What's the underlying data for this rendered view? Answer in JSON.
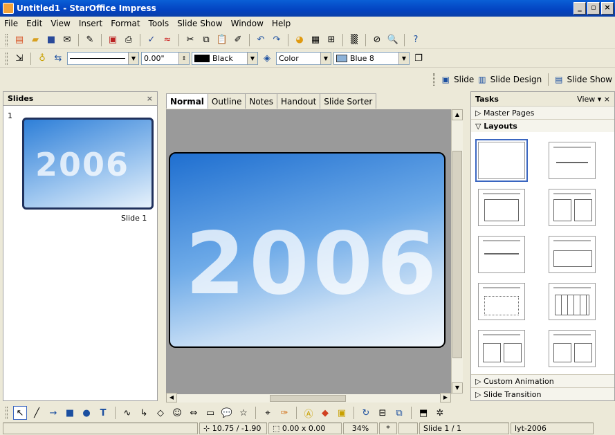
{
  "window": {
    "title": "Untitled1 - StarOffice Impress"
  },
  "menu": [
    "File",
    "Edit",
    "View",
    "Insert",
    "Format",
    "Tools",
    "Slide Show",
    "Window",
    "Help"
  ],
  "line_toolbar": {
    "line_width": "0.00\"",
    "line_color": "Black",
    "fill_type": "Color",
    "fill_color": "Blue 8"
  },
  "presentation_toolbar": {
    "slide": "Slide",
    "slide_design": "Slide Design",
    "slide_show": "Slide Show"
  },
  "slides_panel": {
    "title": "Slides",
    "close": "×",
    "slide_number": "1",
    "slide_name": "Slide 1",
    "slide_text": "2006"
  },
  "view_tabs": [
    "Normal",
    "Outline",
    "Notes",
    "Handout",
    "Slide Sorter"
  ],
  "main_slide": {
    "text": "2006"
  },
  "tasks_panel": {
    "title": "Tasks",
    "view": "View ▾ ×",
    "master_pages": "Master Pages",
    "layouts": "Layouts",
    "custom_animation": "Custom Animation",
    "slide_transition": "Slide Transition"
  },
  "status": {
    "position": "10.75 / -1.90",
    "size": "0.00 x 0.00",
    "zoom": "34%",
    "modified": "*",
    "slide": "Slide 1 / 1",
    "layout": "lyt-2006"
  },
  "colors": {
    "title_bar": "#0a5fd6",
    "slide_blue": "#1f6fd0",
    "selection": "#3a66c0"
  }
}
